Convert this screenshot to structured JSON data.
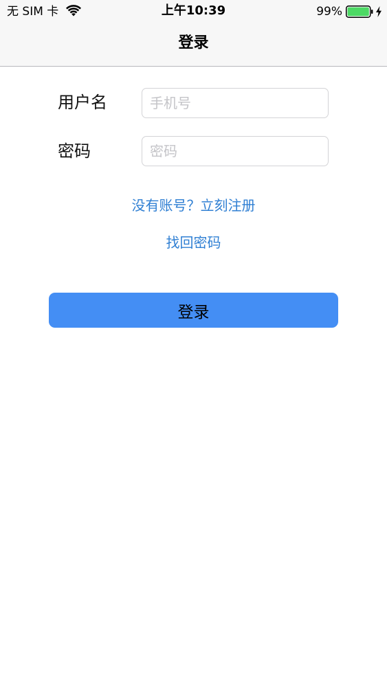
{
  "status_bar": {
    "carrier": "无 SIM 卡",
    "time": "上午10:39",
    "battery_percent": "99%",
    "wifi_icon": "wifi-icon",
    "battery_icon": "battery-icon",
    "charging_icon": "charging-bolt-icon",
    "battery_color": "#4cd964"
  },
  "nav": {
    "title": "登录"
  },
  "form": {
    "username_label": "用户名",
    "username_placeholder": "手机号",
    "username_value": "",
    "password_label": "密码",
    "password_placeholder": "密码",
    "password_value": ""
  },
  "links": {
    "register": "没有账号？立刻注册",
    "forgot_password": "找回密码"
  },
  "login_button": {
    "label": "登录"
  },
  "colors": {
    "link": "#2f7fd3",
    "button_background": "#448ef4",
    "bar_background": "#f7f7f7"
  }
}
